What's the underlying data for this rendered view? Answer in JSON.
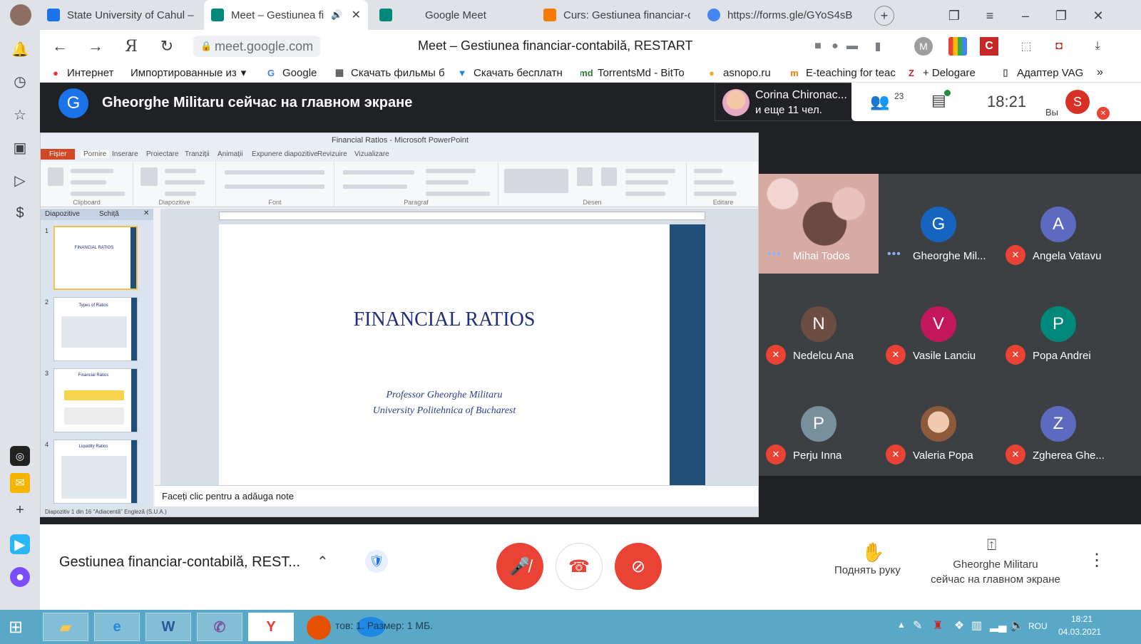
{
  "tabs": [
    {
      "title": "State University of Cahul –",
      "favicon_color": "#1a73e8"
    },
    {
      "title": "Meet – Gestiunea fin",
      "favicon_color": "#00897b",
      "active": true
    },
    {
      "title": "Google Meet",
      "favicon_color": "#00897b"
    },
    {
      "title": "Curs: Gestiunea financiar-c",
      "favicon_color": "#f57c00"
    },
    {
      "title": "https://forms.gle/GYoS4sB",
      "favicon_color": "#4285f4"
    }
  ],
  "address": {
    "url": "meet.google.com",
    "page_title": "Meet – Gestiunea financiar-contabilă, RESTART",
    "profile_letter": "M"
  },
  "bookmarks": [
    {
      "label": "Интернет",
      "icon_color": "#e53935"
    },
    {
      "label": "Импортированные из",
      "icon_color": "#555"
    },
    {
      "label": "Google",
      "icon_color": "#4285f4"
    },
    {
      "label": "Скачать фильмы б",
      "icon_color": "#555"
    },
    {
      "label": "Скачать бесплатн",
      "icon_color": "#1e88e5"
    },
    {
      "label": "TorrentsMd - BitTo",
      "icon_color": "#2e7d32"
    },
    {
      "label": "asnopo.ru",
      "icon_color": "#f9a825"
    },
    {
      "label": "E-teaching for teac",
      "icon_color": "#f57c00"
    },
    {
      "label": "+ Delogare",
      "icon_color": "#c62828"
    },
    {
      "label": "Адаптер VAG",
      "icon_color": "#555"
    }
  ],
  "presenter": {
    "initial": "G",
    "text": "Gheorghe Militaru сейчас на главном экране"
  },
  "top_info": {
    "corina_name": "Corina Chironac...",
    "corina_more": "и еще 11 чел.",
    "participants_count": "23",
    "time": "18:21",
    "self_initial": "S",
    "self_label": "Вы"
  },
  "powerpoint": {
    "window_title": "Financial Ratios - Microsoft PowerPoint",
    "ribbon_tabs": [
      "Fișier",
      "Pornire",
      "Inserare",
      "Proiectare",
      "Tranziții",
      "Animații",
      "Expunere diapozitive",
      "Revizuire",
      "Vizualizare"
    ],
    "ribbon_groups": [
      "Clipboard",
      "Diapozitive",
      "Font",
      "Paragraf",
      "Desen",
      "Editare"
    ],
    "pane_tabs": [
      "Diapozitive",
      "Schiță"
    ],
    "slide_title": "FINANCIAL RATIOS",
    "slide_sub1": "Professor Gheorghe Militaru",
    "slide_sub2": "University Politehnica of Bucharest",
    "notes_placeholder": "Faceți clic pentru a adăuga note",
    "status": "Diapozitiv 1 din 16   \"Adiacentă\"   Engleză (S.U.A.)",
    "thumb_numbers": [
      "1",
      "2",
      "3",
      "4"
    ],
    "thumb_titles": [
      "FINANCIAL RATIOS",
      "Types of Ratios",
      "Financial Ratios",
      "Liquidity Ratios"
    ]
  },
  "participants": [
    {
      "name": "Mihai Todos",
      "initial": "",
      "color": "",
      "state": "dots",
      "photo": true
    },
    {
      "name": "Gheorghe Mil...",
      "initial": "G",
      "color": "#1565c0",
      "state": "dots"
    },
    {
      "name": "Angela Vatavu",
      "initial": "A",
      "color": "#5c6bc0",
      "state": "muted"
    },
    {
      "name": "Nedelcu Ana",
      "initial": "N",
      "color": "#6d4c41",
      "state": "muted"
    },
    {
      "name": "Vasile Lanciu",
      "initial": "V",
      "color": "#c2185b",
      "state": "muted"
    },
    {
      "name": "Popa Andrei",
      "initial": "P",
      "color": "#00897b",
      "state": "muted"
    },
    {
      "name": "Perju Inna",
      "initial": "P",
      "color": "#78909c",
      "state": "muted"
    },
    {
      "name": "Valeria Popa",
      "initial": "",
      "color": "#e8b4a0",
      "state": "muted",
      "photo": true
    },
    {
      "name": "Zgherea Ghe...",
      "initial": "Z",
      "color": "#5c6bc0",
      "state": "muted"
    }
  ],
  "bottom": {
    "meeting_name": "Gestiunea financiar-contabilă, REST...",
    "raise_hand": "Поднять руку",
    "presenting_line1": "Gheorghe Militaru",
    "presenting_line2": "сейчас на главном экране"
  },
  "taskbar": {
    "status_text": "тов: 1. Размер: 1 МБ.",
    "lang": "ROU",
    "time": "18:21",
    "date": "04.03.2021"
  },
  "colors": {
    "meet_bg": "#202124",
    "tile_bg": "#3c4043",
    "danger": "#ea4335",
    "blue": "#1a73e8"
  }
}
